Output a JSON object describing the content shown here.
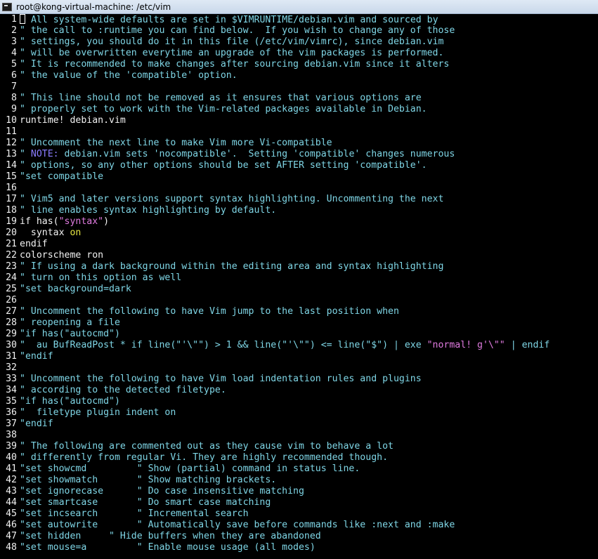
{
  "window": {
    "title": "root@kong-virtual-machine: /etc/vim"
  },
  "colors": {
    "comment": "#7fd6e6",
    "normal": "#f2f2f2",
    "keyword": "#e6e642",
    "string": "#e07be0",
    "todo": "#8a7cff",
    "lineNumber": "#f2f2f2",
    "background": "#000000"
  },
  "icons": {
    "window_icon": "terminal-icon",
    "cursor": "block-cursor"
  },
  "lines": [
    {
      "n": "1",
      "segs": [
        [
          "\" All system-wide defaults are set in $VIMRUNTIME/debian.vim and sourced by",
          "comment"
        ]
      ],
      "cursor": true
    },
    {
      "n": "2",
      "segs": [
        [
          "\" the call to :runtime you can find below.  If you wish to change any of those",
          "comment"
        ]
      ]
    },
    {
      "n": "3",
      "segs": [
        [
          "\" settings, you should do it in this file (/etc/vim/vimrc), since debian.vim",
          "comment"
        ]
      ]
    },
    {
      "n": "4",
      "segs": [
        [
          "\" will be overwritten everytime an upgrade of the vim packages is performed.",
          "comment"
        ]
      ]
    },
    {
      "n": "5",
      "segs": [
        [
          "\" It is recommended to make changes after sourcing debian.vim since it alters",
          "comment"
        ]
      ]
    },
    {
      "n": "6",
      "segs": [
        [
          "\" the value of the 'compatible' option.",
          "comment"
        ]
      ]
    },
    {
      "n": "7",
      "segs": []
    },
    {
      "n": "8",
      "segs": [
        [
          "\" This line should not be removed as it ensures that various options are",
          "comment"
        ]
      ]
    },
    {
      "n": "9",
      "segs": [
        [
          "\" properly set to work with the Vim-related packages available in Debian.",
          "comment"
        ]
      ]
    },
    {
      "n": "10",
      "segs": [
        [
          "runtime! debian.vim",
          "normal"
        ]
      ]
    },
    {
      "n": "11",
      "segs": []
    },
    {
      "n": "12",
      "segs": [
        [
          "\" Uncomment the next line to make Vim more Vi-compatible",
          "comment"
        ]
      ]
    },
    {
      "n": "13",
      "segs": [
        [
          "\" ",
          "comment"
        ],
        [
          "NOTE:",
          "todo"
        ],
        [
          " debian.vim sets 'nocompatible'.  Setting 'compatible' changes numerous",
          "comment"
        ]
      ]
    },
    {
      "n": "14",
      "segs": [
        [
          "\" options, so any other options should be set AFTER setting 'compatible'.",
          "comment"
        ]
      ]
    },
    {
      "n": "15",
      "segs": [
        [
          "\"set compatible",
          "comment"
        ]
      ]
    },
    {
      "n": "16",
      "segs": []
    },
    {
      "n": "17",
      "segs": [
        [
          "\" Vim5 and later versions support syntax highlighting. Uncommenting the next",
          "comment"
        ]
      ]
    },
    {
      "n": "18",
      "segs": [
        [
          "\" line enables syntax highlighting by default.",
          "comment"
        ]
      ]
    },
    {
      "n": "19",
      "segs": [
        [
          "if has(",
          "normal"
        ],
        [
          "\"syntax\"",
          "string"
        ],
        [
          ")",
          "normal"
        ]
      ]
    },
    {
      "n": "20",
      "segs": [
        [
          "  syntax ",
          "normal"
        ],
        [
          "on",
          "keyword"
        ]
      ]
    },
    {
      "n": "21",
      "segs": [
        [
          "endif",
          "normal"
        ]
      ]
    },
    {
      "n": "22",
      "segs": [
        [
          "colorscheme ron",
          "normal"
        ]
      ]
    },
    {
      "n": "23",
      "segs": [
        [
          "\" If using a dark background within the editing area and syntax highlighting",
          "comment"
        ]
      ]
    },
    {
      "n": "24",
      "segs": [
        [
          "\" turn on this option as well",
          "comment"
        ]
      ]
    },
    {
      "n": "25",
      "segs": [
        [
          "\"set background=dark",
          "comment"
        ]
      ]
    },
    {
      "n": "26",
      "segs": []
    },
    {
      "n": "27",
      "segs": [
        [
          "\" Uncomment the following to have Vim jump to the last position when",
          "comment"
        ]
      ]
    },
    {
      "n": "28",
      "segs": [
        [
          "\" reopening a file",
          "comment"
        ]
      ]
    },
    {
      "n": "29",
      "segs": [
        [
          "\"if has(\"autocmd\")",
          "comment"
        ]
      ]
    },
    {
      "n": "30",
      "segs": [
        [
          "\"  au BufReadPost * if line(\"'\\\"\") > 1 && line(\"'\\\"\") <= line(\"$\") | exe ",
          "comment"
        ],
        [
          "\"normal! g'\\\"\"",
          "string"
        ],
        [
          " | endif",
          "comment"
        ]
      ]
    },
    {
      "n": "31",
      "segs": [
        [
          "\"endif",
          "comment"
        ]
      ]
    },
    {
      "n": "32",
      "segs": []
    },
    {
      "n": "33",
      "segs": [
        [
          "\" Uncomment the following to have Vim load indentation rules and plugins",
          "comment"
        ]
      ]
    },
    {
      "n": "34",
      "segs": [
        [
          "\" according to the detected filetype.",
          "comment"
        ]
      ]
    },
    {
      "n": "35",
      "segs": [
        [
          "\"if has(\"autocmd\")",
          "comment"
        ]
      ]
    },
    {
      "n": "36",
      "segs": [
        [
          "\"  filetype plugin indent on",
          "comment"
        ]
      ]
    },
    {
      "n": "37",
      "segs": [
        [
          "\"endif",
          "comment"
        ]
      ]
    },
    {
      "n": "38",
      "segs": []
    },
    {
      "n": "39",
      "segs": [
        [
          "\" The following are commented out as they cause vim to behave a lot",
          "comment"
        ]
      ]
    },
    {
      "n": "40",
      "segs": [
        [
          "\" differently from regular Vi. They are highly recommended though.",
          "comment"
        ]
      ]
    },
    {
      "n": "41",
      "segs": [
        [
          "\"set showcmd         \" Show (partial) command in status line.",
          "comment"
        ]
      ]
    },
    {
      "n": "42",
      "segs": [
        [
          "\"set showmatch       \" Show matching brackets.",
          "comment"
        ]
      ]
    },
    {
      "n": "43",
      "segs": [
        [
          "\"set ignorecase      \" Do case insensitive matching",
          "comment"
        ]
      ]
    },
    {
      "n": "44",
      "segs": [
        [
          "\"set smartcase       \" Do smart case matching",
          "comment"
        ]
      ]
    },
    {
      "n": "45",
      "segs": [
        [
          "\"set incsearch       \" Incremental search",
          "comment"
        ]
      ]
    },
    {
      "n": "46",
      "segs": [
        [
          "\"set autowrite       \" Automatically save before commands like :next and :make",
          "comment"
        ]
      ]
    },
    {
      "n": "47",
      "segs": [
        [
          "\"set hidden     \" Hide buffers when they are abandoned",
          "comment"
        ]
      ]
    },
    {
      "n": "48",
      "segs": [
        [
          "\"set mouse=a         \" Enable mouse usage (all modes)",
          "comment"
        ]
      ]
    }
  ]
}
